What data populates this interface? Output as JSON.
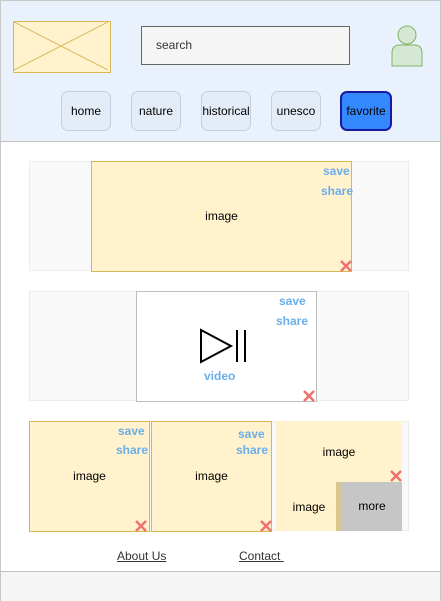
{
  "header": {
    "logo_icon": "image-placeholder-icon",
    "search": {
      "placeholder": "search"
    },
    "avatar_icon": "user-icon",
    "nav": [
      {
        "label": "home",
        "active": false
      },
      {
        "label": "nature",
        "active": false
      },
      {
        "label": "historical",
        "active": false
      },
      {
        "label": "unesco",
        "active": false
      },
      {
        "label": "favorite",
        "active": true
      }
    ]
  },
  "feed": {
    "post1": {
      "caption": "image",
      "save": "save",
      "share": "share"
    },
    "post2": {
      "caption": "video",
      "save": "save",
      "share": "share",
      "icon": "play-pause-icon"
    },
    "post3": {
      "tile1": {
        "caption": "image",
        "save": "save",
        "share": "share"
      },
      "tile2": {
        "caption": "image",
        "save": "save",
        "share": "share"
      },
      "tile3": {
        "caption": "image"
      },
      "tile4": {
        "caption": "image"
      },
      "more": "more"
    }
  },
  "footer": {
    "about": "About Us",
    "contact": "Contact "
  },
  "colors": {
    "header_bg": "#e9f1fc",
    "image_fill": "#fff2cc",
    "image_border": "#d6b656",
    "active_tab": "#3589ff",
    "link": "#6aaee9",
    "delete": "#f07070"
  }
}
